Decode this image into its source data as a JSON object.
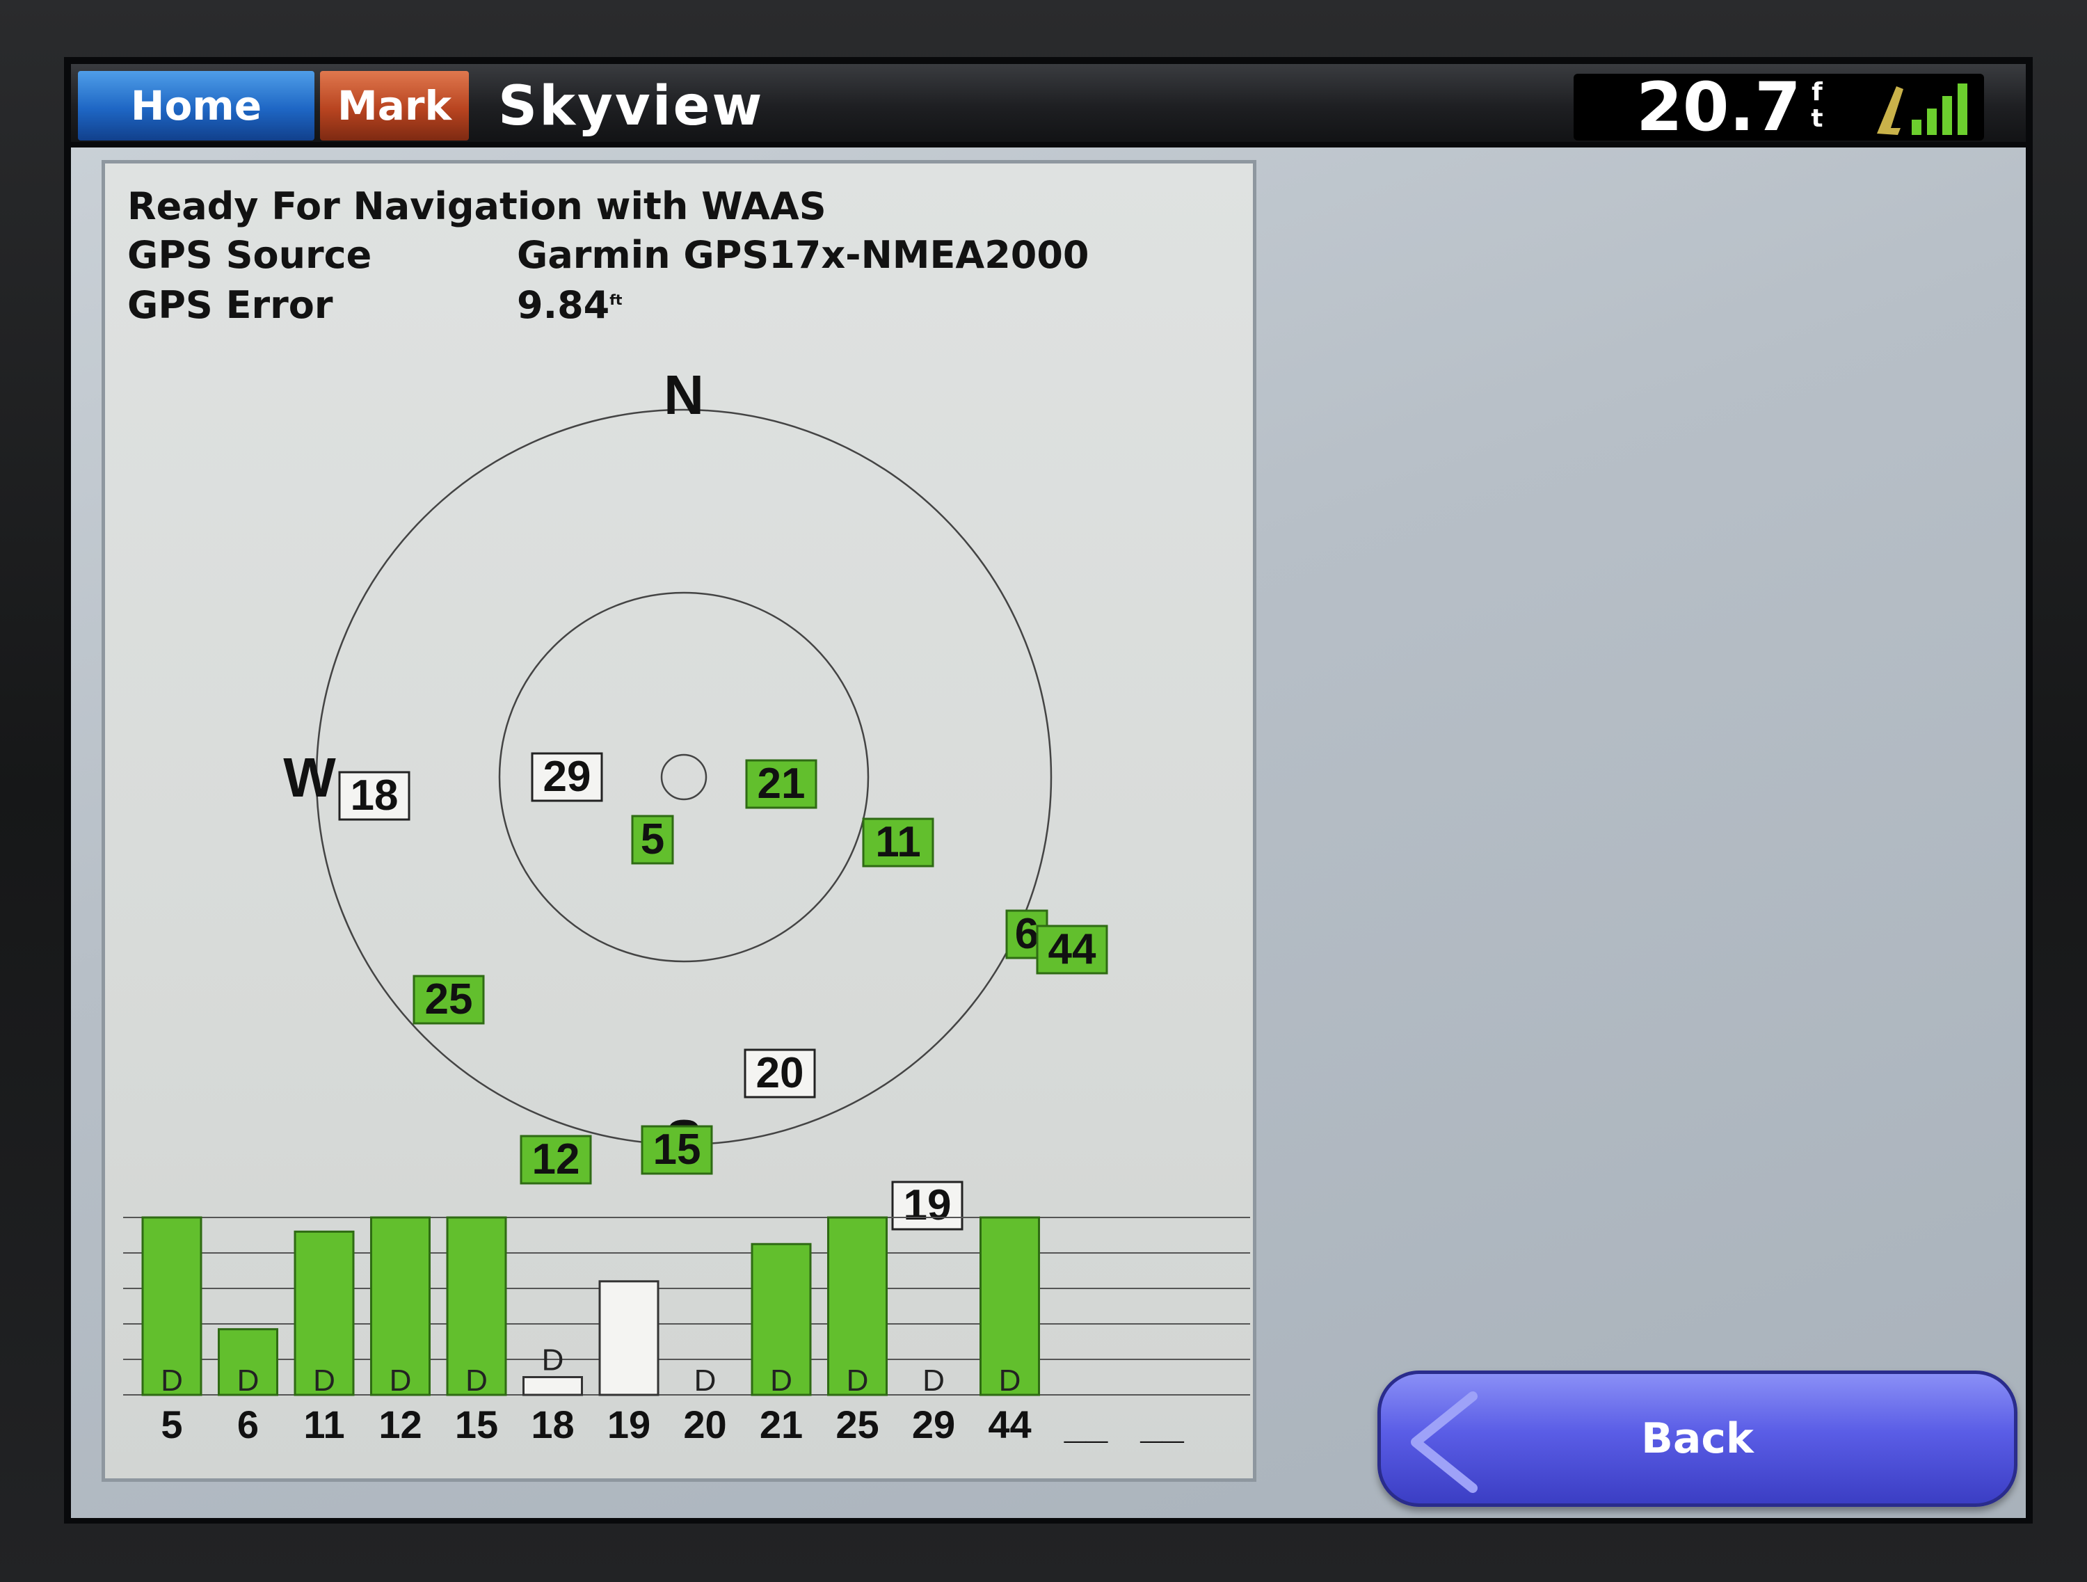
{
  "header": {
    "home_label": "Home",
    "mark_label": "Mark",
    "title": "Skyview",
    "depth_value": "20.7",
    "depth_unit_top": "f",
    "depth_unit_bottom": "t",
    "signal_bars": 4
  },
  "status": {
    "ready": "Ready For Navigation with WAAS",
    "gps_source_label": "GPS Source",
    "gps_source_value": "Garmin GPS17x-NMEA2000",
    "gps_error_label": "GPS Error",
    "gps_error_value": "9.84",
    "gps_error_unit": "ft"
  },
  "compass": {
    "north": "N",
    "south": "S",
    "west": "W"
  },
  "satellites": [
    {
      "id": "18",
      "tracked": false
    },
    {
      "id": "29",
      "tracked": false
    },
    {
      "id": "21",
      "tracked": true
    },
    {
      "id": "5",
      "tracked": true
    },
    {
      "id": "11",
      "tracked": true
    },
    {
      "id": "6",
      "tracked": true
    },
    {
      "id": "44",
      "tracked": true
    },
    {
      "id": "25",
      "tracked": true
    },
    {
      "id": "20",
      "tracked": false
    },
    {
      "id": "15",
      "tracked": true
    },
    {
      "id": "12",
      "tracked": true
    },
    {
      "id": "19",
      "tracked": false
    }
  ],
  "chart_data": {
    "type": "bar",
    "categories": [
      "5",
      "6",
      "11",
      "12",
      "15",
      "18",
      "19",
      "20",
      "21",
      "25",
      "29",
      "44",
      "__",
      "__"
    ],
    "values": [
      1.0,
      0.37,
      0.92,
      1.0,
      1.0,
      0.1,
      0.64,
      0.0,
      0.85,
      1.0,
      0.0,
      1.0,
      0.0,
      0.0
    ],
    "tracked": [
      true,
      true,
      true,
      true,
      true,
      false,
      false,
      false,
      true,
      true,
      false,
      true,
      false,
      false
    ],
    "diff_flags": [
      "D",
      "D",
      "D",
      "D",
      "D",
      "D",
      "",
      "D",
      "D",
      "D",
      "D",
      "D",
      "",
      ""
    ],
    "ylim": [
      0,
      1
    ],
    "grid": true
  },
  "footer": {
    "back_label": "Back"
  },
  "colors": {
    "tracked": "#62bf2d",
    "untracked": "#f4f4f2",
    "home": "#1e66c4",
    "mark": "#b84420",
    "back": "#5a5de6"
  }
}
